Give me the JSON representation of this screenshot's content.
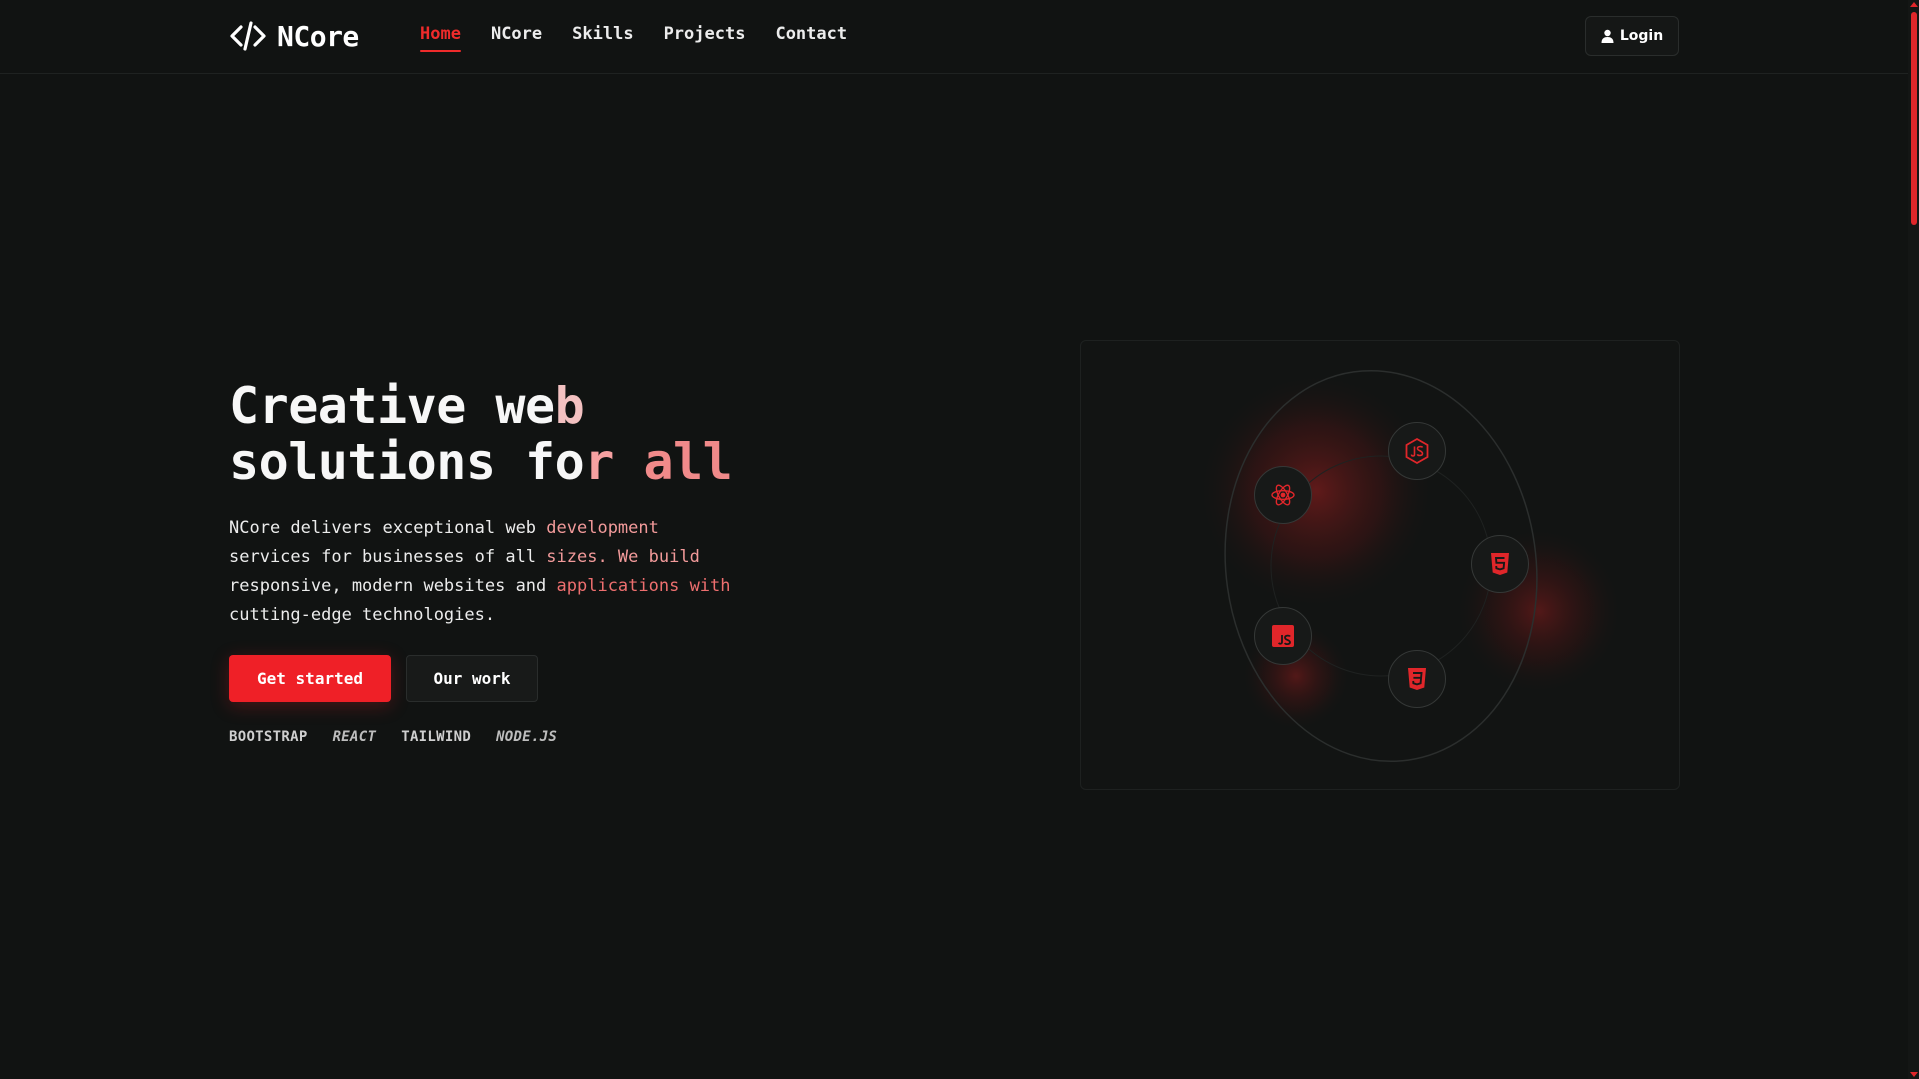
{
  "brand": {
    "name": "NCore",
    "logo_icon": "code-brackets-icon"
  },
  "nav": {
    "items": [
      {
        "label": "Home",
        "active": true
      },
      {
        "label": "NCore",
        "active": false
      },
      {
        "label": "Skills",
        "active": false
      },
      {
        "label": "Projects",
        "active": false
      },
      {
        "label": "Contact",
        "active": false
      }
    ]
  },
  "header": {
    "login_label": "Login",
    "login_icon": "user-icon"
  },
  "hero": {
    "title_line1_a": "Creative we",
    "title_line1_b": "b",
    "title_line2_a": "solutions fo",
    "title_line2_b": "r ",
    "title_line2_c": "all",
    "desc_1": "NCore delivers exceptional web ",
    "desc_2": "development",
    "desc_3": "services for businesses of all ",
    "desc_4": "sizes. We build",
    "desc_5": "responsive, modern websites and ",
    "desc_6": "applications with",
    "desc_7": "cutting-edge technologies.",
    "primary_button": "Get started",
    "secondary_button": "Our work",
    "tech_tags": [
      "BOOTSTRAP",
      "REACT",
      "TAILWIND",
      "NODE.JS"
    ]
  },
  "orbit": {
    "icons": [
      "react-icon",
      "nodejs-icon",
      "html5-icon",
      "javascript-icon",
      "css3-icon"
    ]
  },
  "colors": {
    "background": "#111312",
    "accent": "#ef2027",
    "accent_soft": "#f29a9a",
    "text": "#f2f2f2"
  }
}
